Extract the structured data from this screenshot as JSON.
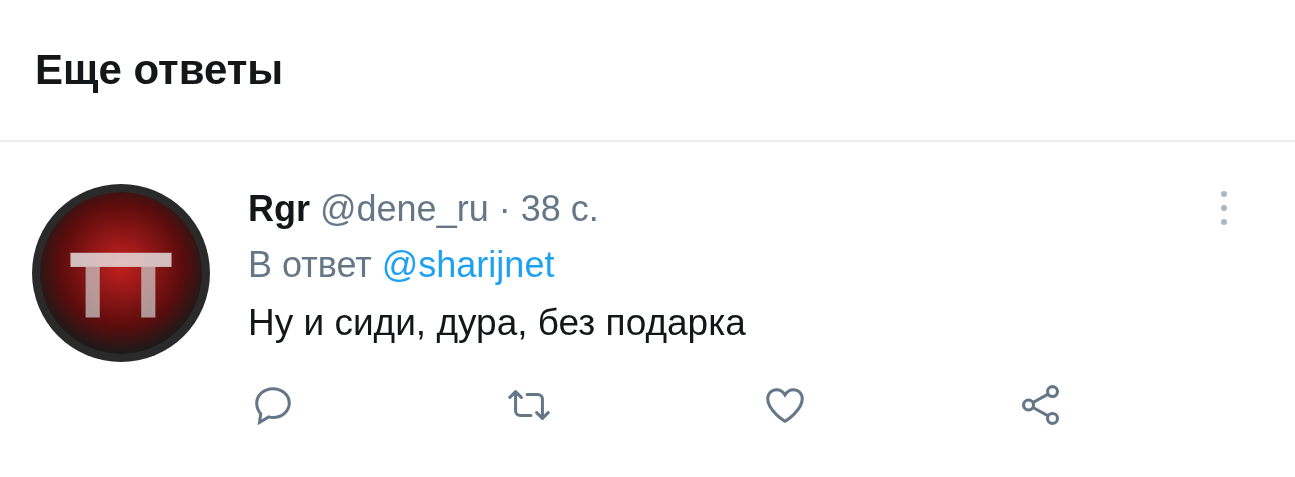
{
  "section_title": "Еще ответы",
  "tweet": {
    "name": "Rgr",
    "handle": "@dene_ru",
    "separator": "·",
    "time": "38 с.",
    "reply_prefix": "В ответ",
    "reply_to": "@sharijnet",
    "text": "Ну и сиди, дура, без подарка"
  }
}
